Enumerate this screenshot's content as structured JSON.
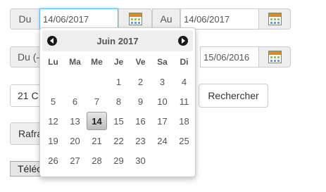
{
  "row1": {
    "label": "Du",
    "date_value": "14/06/2017",
    "label2": "Au",
    "date_value2": "14/06/2017"
  },
  "row2": {
    "label": "Du (-",
    "date_value2": "15/06/2016"
  },
  "row3": {
    "select_value": "21 C",
    "search_button": "Rechercher"
  },
  "row4": {
    "refresh_button": "Rafra"
  },
  "row5": {
    "download_tab": "Téléc"
  },
  "datepicker": {
    "month_title": "Juin 2017",
    "weekdays": [
      "Lu",
      "Ma",
      "Me",
      "Je",
      "Ve",
      "Sa",
      "Di"
    ],
    "leading_blanks": 3,
    "days": [
      "1",
      "2",
      "3",
      "4",
      "5",
      "6",
      "7",
      "8",
      "9",
      "10",
      "11",
      "12",
      "13",
      "14",
      "15",
      "16",
      "17",
      "18",
      "19",
      "20",
      "21",
      "22",
      "23",
      "24",
      "25",
      "26",
      "27",
      "28",
      "29",
      "30"
    ],
    "selected_day": "14",
    "prev_icon": "chevron-left-circle-icon",
    "next_icon": "chevron-right-circle-icon"
  },
  "icons": {
    "calendar": "calendar-icon"
  }
}
